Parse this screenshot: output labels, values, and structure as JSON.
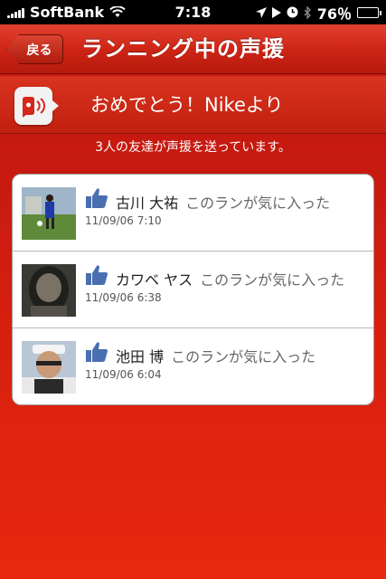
{
  "status_bar": {
    "carrier": "SoftBank",
    "time": "7:18",
    "battery": "76％",
    "battery_level": 0.76
  },
  "nav": {
    "back_label": "戻る",
    "title": "ランニング中の声援"
  },
  "banner": {
    "message": "おめでとう！Nikeより",
    "icon": "cheer-speaker-icon"
  },
  "subtitle": "3人の友達が声援を送っています。",
  "cheers": [
    {
      "name": "古川 大祐",
      "action": "このランが気に入った",
      "datetime": "11/09/06  7:10",
      "icon": "thumbs-up-icon"
    },
    {
      "name": "カワベ ヤス",
      "action": "このランが気に入った",
      "datetime": "11/09/06  6:38",
      "icon": "thumbs-up-icon"
    },
    {
      "name": "池田 博",
      "action": "このランが気に入った",
      "datetime": "11/09/06  6:04",
      "icon": "thumbs-up-icon"
    }
  ],
  "colors": {
    "background": "#d8200f",
    "nav": "#cf2516",
    "like_blue": "#4a6fb0"
  }
}
